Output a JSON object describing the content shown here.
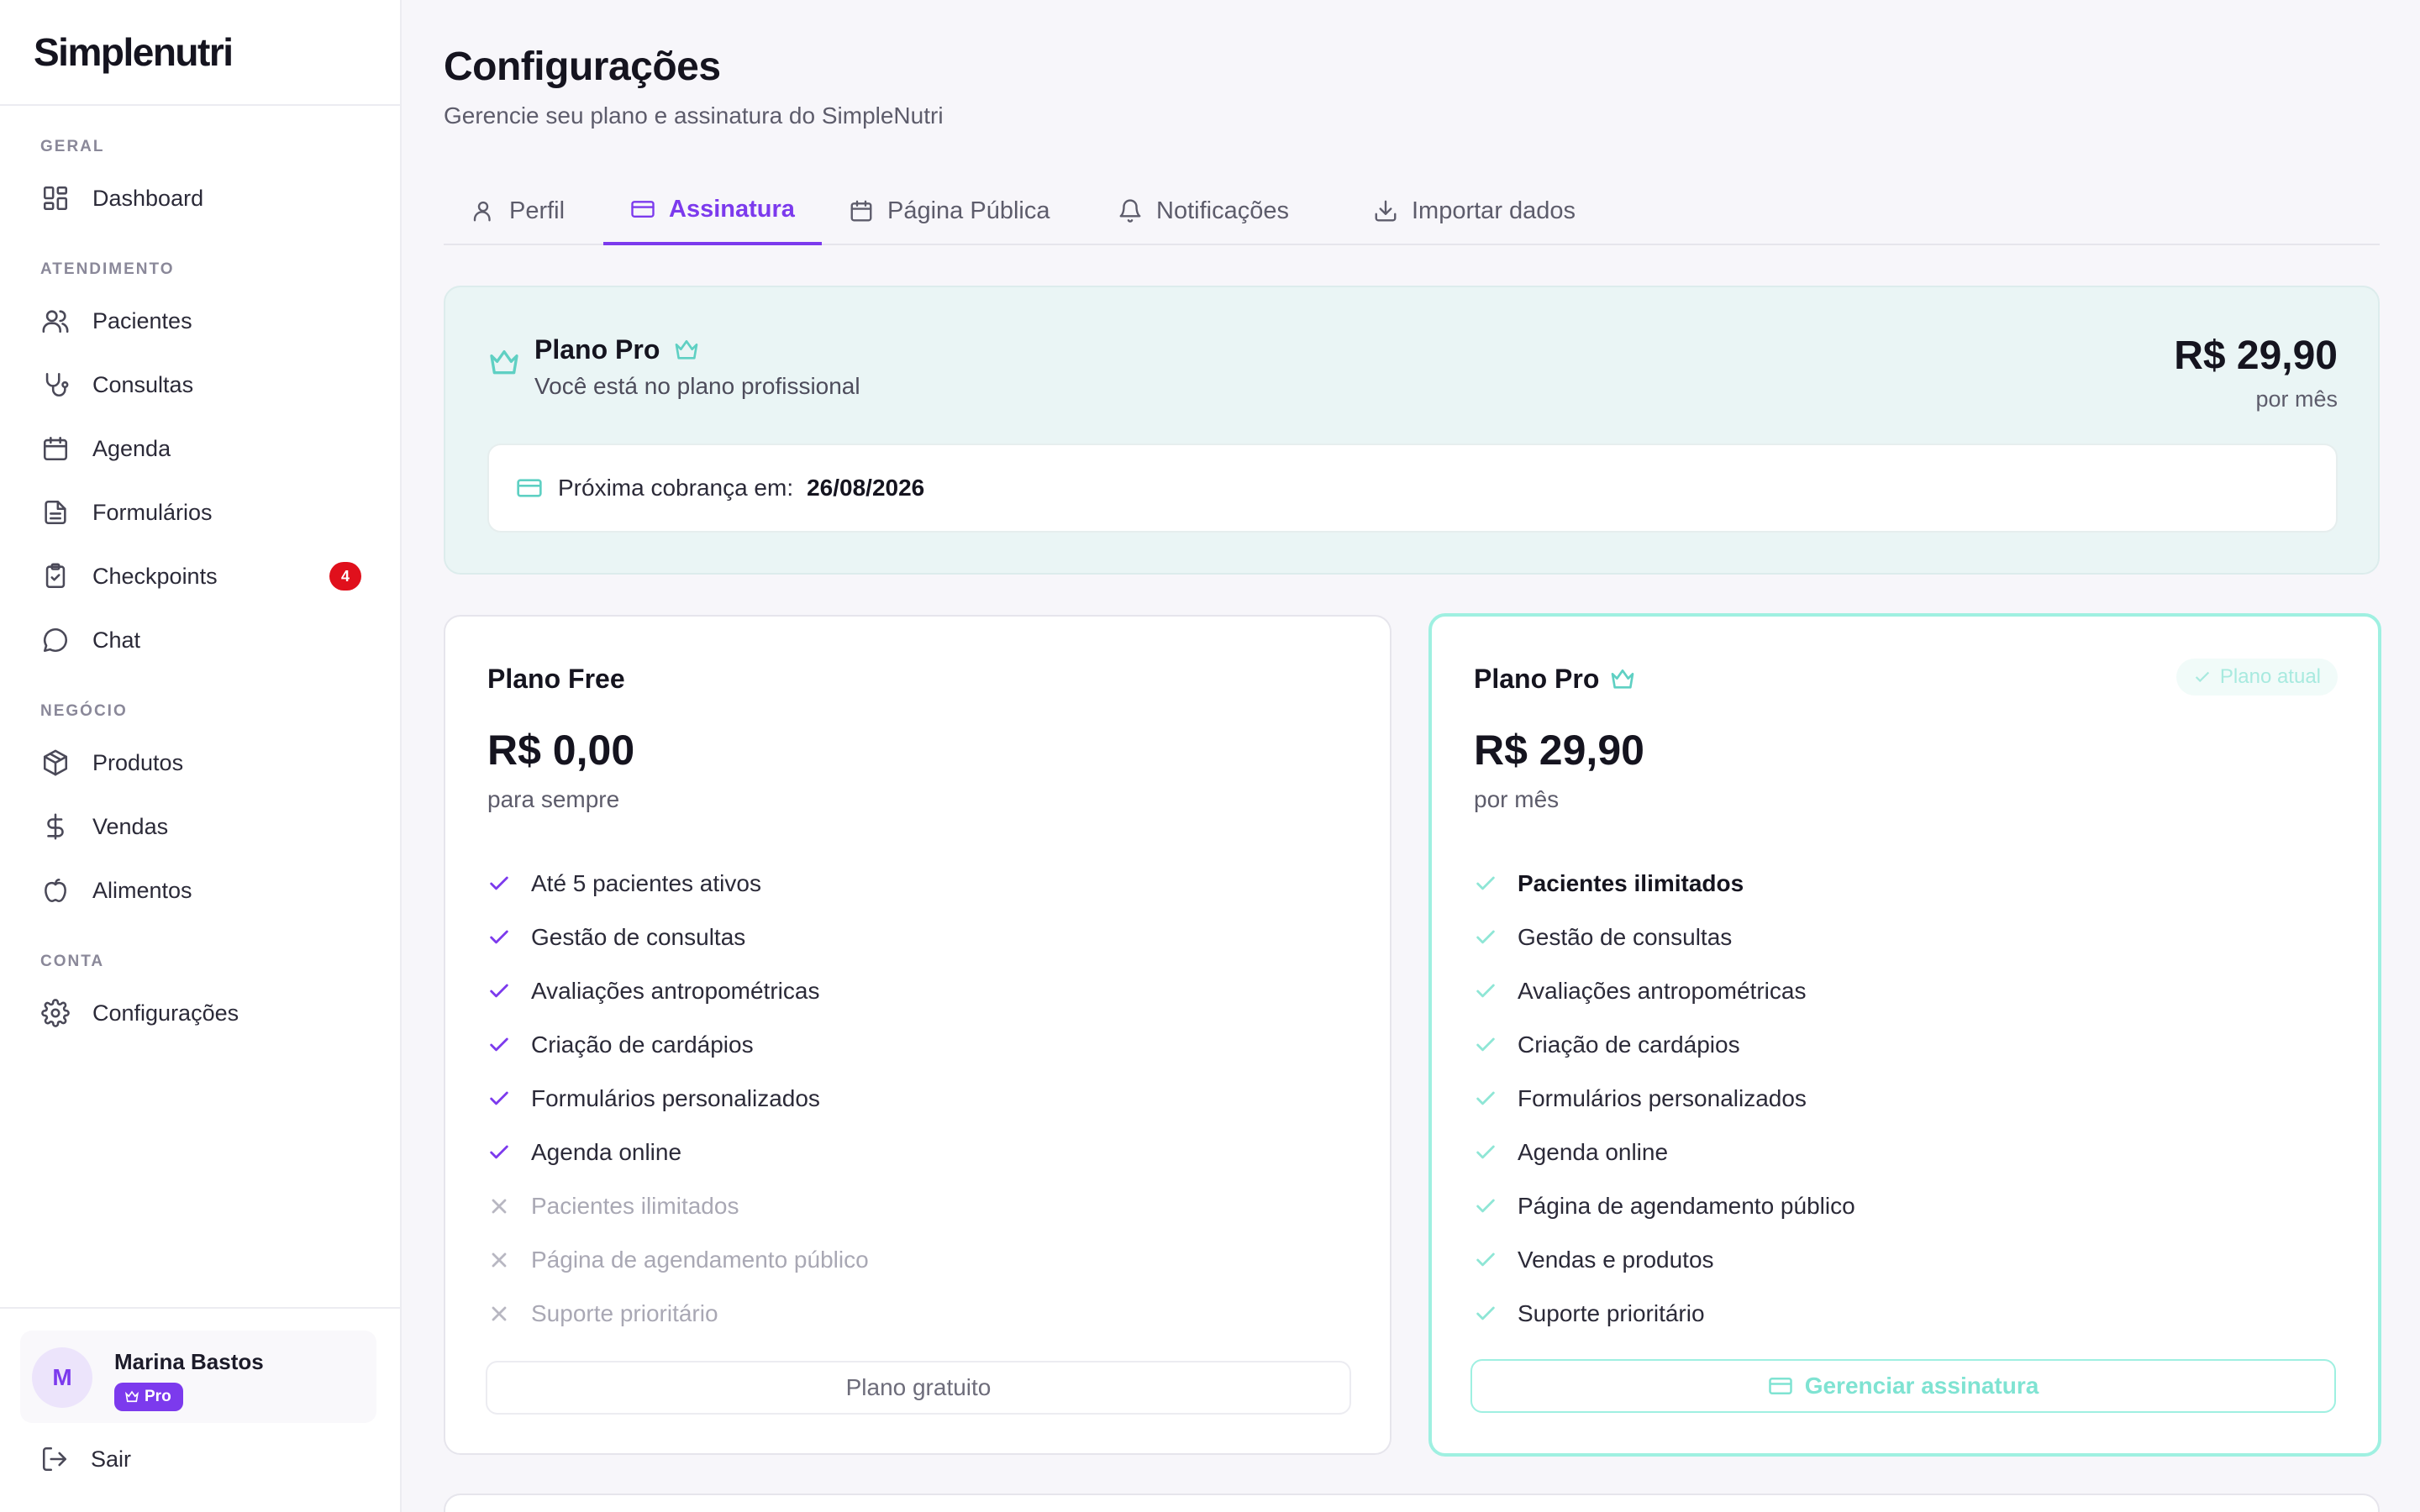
{
  "brand": {
    "name": "Simplenutri"
  },
  "sidebar": {
    "sections": {
      "geral": "GERAL",
      "atendimento": "ATENDIMENTO",
      "negocio": "NEGÓCIO",
      "conta": "CONTA"
    },
    "items": {
      "dashboard": {
        "label": "Dashboard",
        "icon": "dashboard-icon"
      },
      "pacientes": {
        "label": "Pacientes",
        "icon": "users-icon"
      },
      "consultas": {
        "label": "Consultas",
        "icon": "stethoscope-icon"
      },
      "agenda": {
        "label": "Agenda",
        "icon": "calendar-icon"
      },
      "formularios": {
        "label": "Formulários",
        "icon": "file-text-icon"
      },
      "checkpoints": {
        "label": "Checkpoints",
        "icon": "clipboard-check-icon",
        "badge": "4"
      },
      "chat": {
        "label": "Chat",
        "icon": "message-circle-icon"
      },
      "produtos": {
        "label": "Produtos",
        "icon": "package-icon"
      },
      "vendas": {
        "label": "Vendas",
        "icon": "dollar-icon"
      },
      "alimentos": {
        "label": "Alimentos",
        "icon": "apple-icon"
      },
      "configuracoes": {
        "label": "Configurações",
        "icon": "gear-icon"
      }
    },
    "user": {
      "initial": "M",
      "name": "Marina Bastos",
      "plan_badge": "Pro"
    },
    "logout": "Sair"
  },
  "header": {
    "title": "Configurações",
    "subtitle": "Gerencie seu plano e assinatura do SimpleNutri"
  },
  "tabs": {
    "perfil": "Perfil",
    "assinatura": "Assinatura",
    "pagina_publica": "Página Pública",
    "notificacoes": "Notificações",
    "importar": "Importar dados",
    "active": "assinatura"
  },
  "current_plan": {
    "title": "Plano Pro",
    "description": "Você está no plano profissional",
    "price": "R$ 29,90",
    "period": "por mês",
    "next_billing_label": "Próxima cobrança em:",
    "next_billing_date": "26/08/2026"
  },
  "plans": {
    "free": {
      "title": "Plano Free",
      "price": "R$ 0,00",
      "period": "para sempre",
      "features": [
        {
          "text": "Até 5 pacientes ativos",
          "included": true
        },
        {
          "text": "Gestão de consultas",
          "included": true
        },
        {
          "text": "Avaliações antropométricas",
          "included": true
        },
        {
          "text": "Criação de cardápios",
          "included": true
        },
        {
          "text": "Formulários personalizados",
          "included": true
        },
        {
          "text": "Agenda online",
          "included": true
        },
        {
          "text": "Pacientes ilimitados",
          "included": false
        },
        {
          "text": "Página de agendamento público",
          "included": false
        },
        {
          "text": "Suporte prioritário",
          "included": false
        }
      ],
      "button": "Plano gratuito"
    },
    "pro": {
      "title": "Plano Pro",
      "badge": "Plano atual",
      "price": "R$ 29,90",
      "period": "por mês",
      "features": [
        {
          "text": "Pacientes ilimitados",
          "included": true
        },
        {
          "text": "Gestão de consultas",
          "included": true
        },
        {
          "text": "Avaliações antropométricas",
          "included": true
        },
        {
          "text": "Criação de cardápios",
          "included": true
        },
        {
          "text": "Formulários personalizados",
          "included": true
        },
        {
          "text": "Agenda online",
          "included": true
        },
        {
          "text": "Página de agendamento público",
          "included": true
        },
        {
          "text": "Vendas e produtos",
          "included": true
        },
        {
          "text": "Suporte prioritário",
          "included": true
        }
      ],
      "button": "Gerenciar assinatura"
    }
  },
  "colors": {
    "accent": "#7c3aed",
    "teal": "#5fd0c3",
    "badge_red": "#e0101c"
  }
}
